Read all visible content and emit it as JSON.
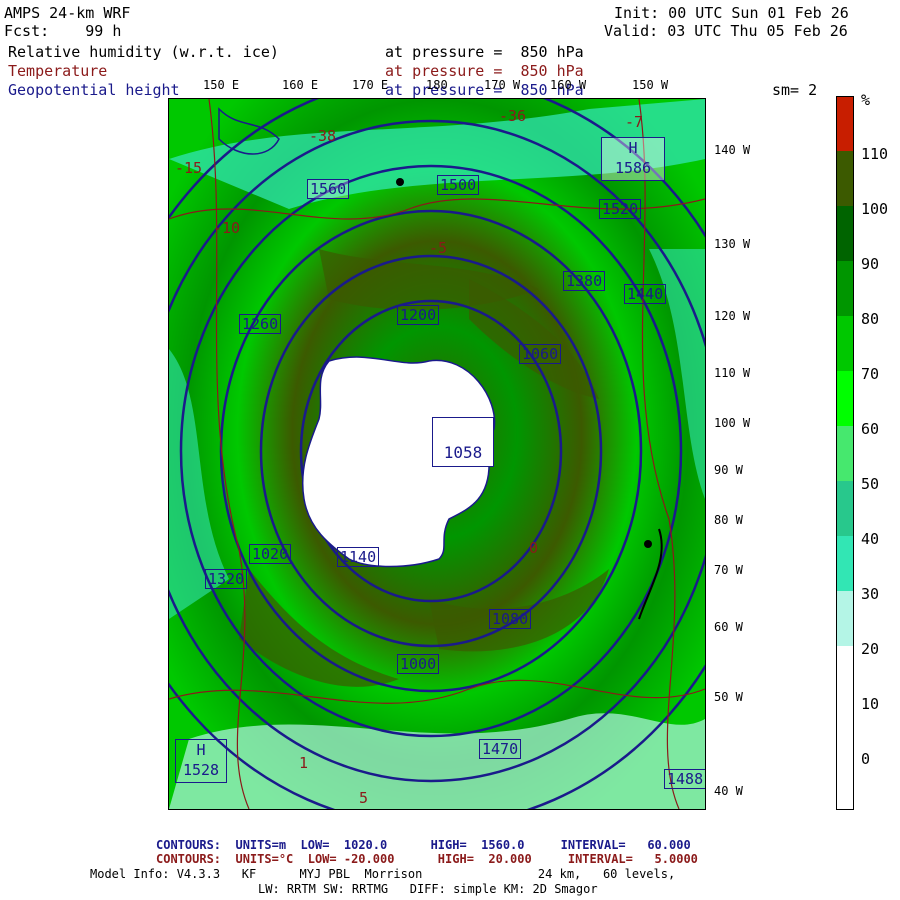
{
  "header": {
    "model": "AMPS 24-km WRF",
    "forecast_label": "Fcst:",
    "forecast_value": "99 h",
    "init": "Init: 00 UTC Sun 01 Feb 26",
    "valid": "Valid: 03 UTC Thu 05 Feb 26",
    "fields": [
      {
        "name": "Relative humidity (w.r.t. ice)",
        "level": "at pressure =  850 hPa",
        "color": "#000000"
      },
      {
        "name": "Temperature",
        "level": "at pressure =  850 hPa",
        "color": "#8b1a1a"
      },
      {
        "name": "Geopotential height",
        "level": "at pressure =  850 hPa",
        "color": "#1a1a8b"
      }
    ],
    "smoothing": "sm= 2"
  },
  "lon_labels": [
    "150 E",
    "160 E",
    "170 E",
    "180",
    "170 W",
    "160 W",
    "150 W"
  ],
  "lat_labels": [
    "140 W",
    "130 W",
    "120 W",
    "110 W",
    "100 W",
    "90 W",
    "80 W",
    "70 W",
    "60 W",
    "50 W",
    "40 W"
  ],
  "height_labels": [
    "H",
    "1586",
    "H",
    "1528",
    "1560",
    "1520",
    "1500",
    "1440",
    "1380",
    "1320",
    "1260",
    "1200",
    "1140",
    "1080",
    "1058",
    "1060",
    "1020",
    "1000",
    "1470",
    "1488"
  ],
  "temp_labels": [
    "-15",
    "-10",
    "-5",
    "-38",
    "-36",
    "-7",
    "5",
    "1",
    "0"
  ],
  "colorbar": {
    "unit": "%",
    "labels": [
      "110",
      "100",
      "90",
      "80",
      "70",
      "60",
      "50",
      "40",
      "30",
      "20",
      "10",
      "0"
    ],
    "colors": [
      "#c81e00",
      "#3c5a00",
      "#006400",
      "#009600",
      "#00c800",
      "#00ff00",
      "#46e86e",
      "#28c88c",
      "#32e6b4",
      "#b4f5e6",
      "#ffffff",
      "#ffffff",
      "#ffffff"
    ]
  },
  "footer": {
    "contours1": {
      "label": "CONTOURS:",
      "units": "UNITS=m",
      "low": "LOW=  1020.0",
      "high": "HIGH=  1560.0",
      "interval": "INTERVAL=   60.000",
      "color": "#1a1a8b"
    },
    "contours2": {
      "label": "CONTOURS:",
      "units": "UNITS=°C",
      "low": "LOW= -20.000",
      "high": "HIGH=  20.000",
      "interval": "INTERVAL=   5.0000",
      "color": "#8b1a1a"
    },
    "model_info_line1": "Model Info: V4.3.3   KF      MYJ PBL  Morrison                24 km,   60 levels,",
    "model_info_line2": "LW: RRTM SW: RRTMG   DIFF: simple KM: 2D Smagor"
  }
}
